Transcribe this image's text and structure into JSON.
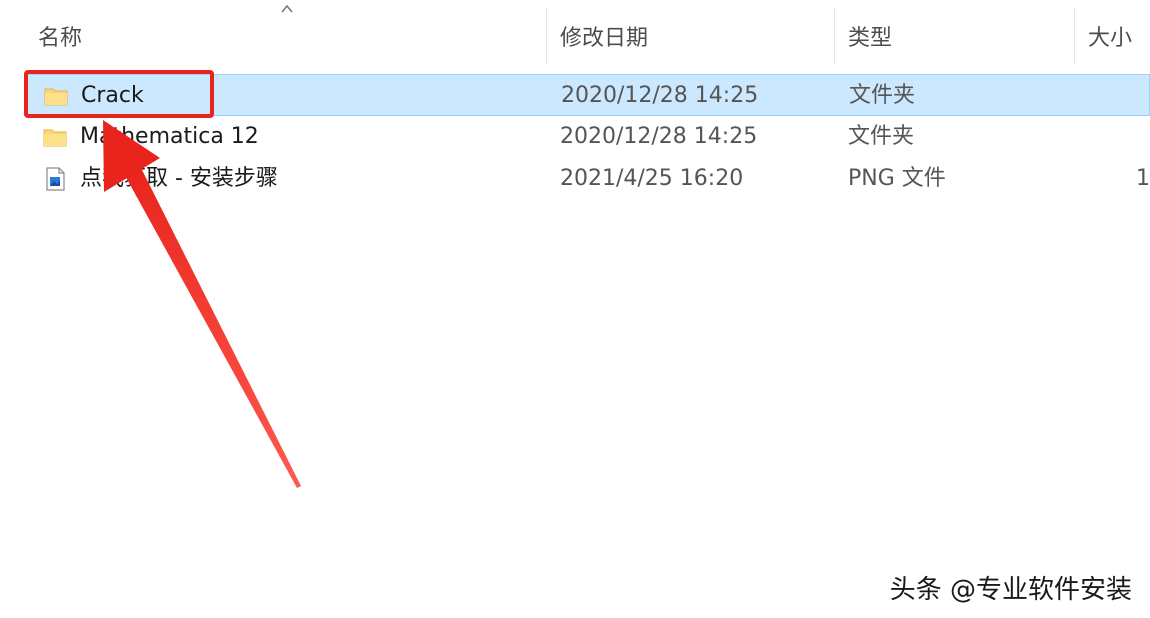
{
  "columns": {
    "name": "名称",
    "date": "修改日期",
    "type": "类型",
    "size": "大小"
  },
  "files": [
    {
      "name": "Crack",
      "date": "2020/12/28 14:25",
      "type": "文件夹",
      "size": "",
      "icon": "folder-icon",
      "selected": true
    },
    {
      "name": "Mathematica 12",
      "date": "2020/12/28 14:25",
      "type": "文件夹",
      "size": "",
      "icon": "folder-icon",
      "selected": false
    },
    {
      "name": "点我获取 - 安装步骤",
      "date": "2021/4/25 16:20",
      "type": "PNG 文件",
      "size": "1",
      "icon": "png-file-icon",
      "selected": false
    }
  ],
  "annotation": {
    "highlight_color": "#e8241c",
    "selection_color": "#cce8ff"
  },
  "watermark": "头条 @专业软件安装"
}
